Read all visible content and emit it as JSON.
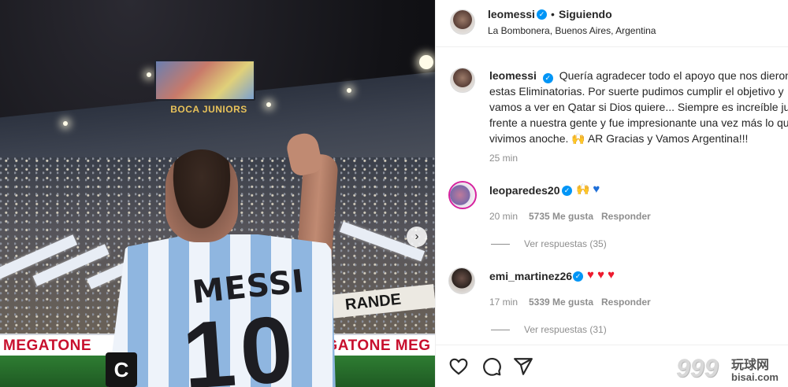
{
  "photo": {
    "scoreboard_label": "BOCA JUNIORS",
    "jersey_name": "MESSI",
    "jersey_number": "10",
    "captain_band": "C",
    "ad_left": "MEGATONE",
    "ad_right": "MEGATONE MEG",
    "stand_sign": "RANDE DEL",
    "next_icon": "chevron-right"
  },
  "header": {
    "username": "leomessi",
    "separator": "•",
    "follow_label": "Siguiendo",
    "location": "La Bombonera, Buenos Aires, Argentina"
  },
  "caption": {
    "username": "leomessi",
    "lines": [
      "Quería agradecer todo el apoyo que nos dieron e",
      "estas Eliminatorias. Por suerte pudimos cumplir el objetivo y",
      "vamos a ver en Qatar si Dios quiere... Siempre es increíble jug",
      "frente a nuestra gente y fue impresionante una vez más lo qu",
      "vivimos anoche. 🙌 AR Gracias y Vamos Argentina!!!"
    ],
    "time": "25 min"
  },
  "comments": [
    {
      "username": "leoparedes20",
      "emoji": "🙌",
      "heart": "♥",
      "time": "20 min",
      "likes": "5735 Me gusta",
      "reply_label": "Responder",
      "view_replies": "Ver respuestas (35)"
    },
    {
      "username": "emi_martinez26",
      "hearts": "♥ ♥ ♥",
      "time": "17 min",
      "likes": "5339 Me gusta",
      "reply_label": "Responder",
      "view_replies": "Ver respuestas (31)"
    }
  ],
  "watermark": {
    "number": "999",
    "chinese": "玩球网",
    "url": "bisai.com"
  },
  "colors": {
    "verified": "#0095f6",
    "heart_red": "#ed1b2e",
    "heart_blue": "#1f6fd8",
    "secondary_text": "#8e8e8e"
  }
}
